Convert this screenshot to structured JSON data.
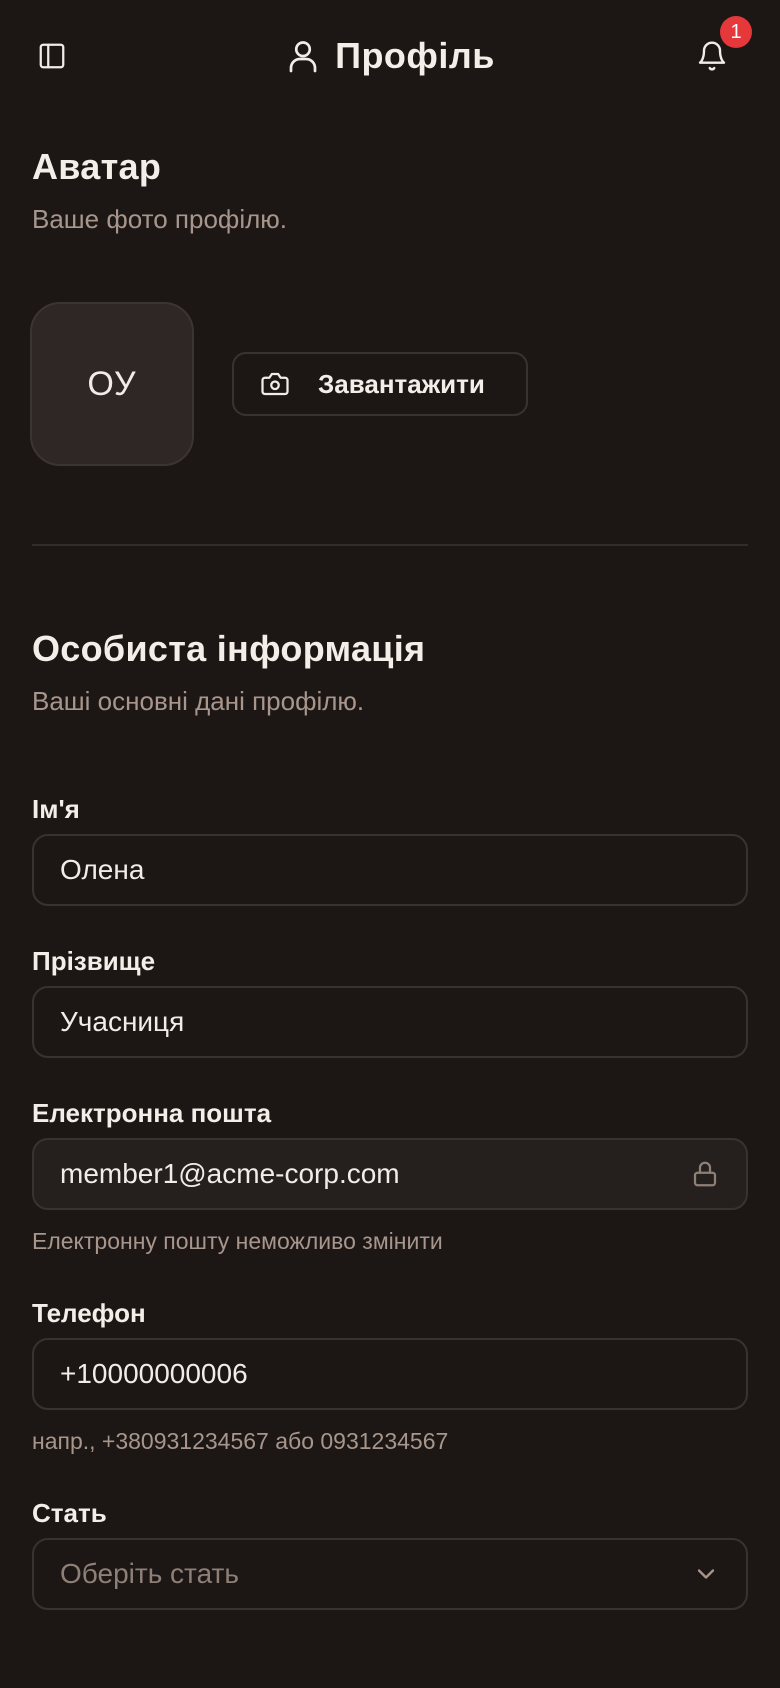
{
  "header": {
    "title": "Профіль",
    "notification_count": "1"
  },
  "avatar_section": {
    "title": "Аватар",
    "subtitle": "Ваше фото профілю.",
    "initials": "ОУ",
    "upload_label": "Завантажити"
  },
  "personal_section": {
    "title": "Особиста інформація",
    "subtitle": "Ваші основні дані профілю."
  },
  "fields": {
    "first_name": {
      "label": "Ім'я",
      "value": "Олена"
    },
    "last_name": {
      "label": "Прізвище",
      "value": "Учасниця"
    },
    "email": {
      "label": "Електронна пошта",
      "value": "member1@acme-corp.com",
      "hint": "Електронну пошту неможливо змінити"
    },
    "phone": {
      "label": "Телефон",
      "value": "+10000000006",
      "hint": "напр., +380931234567 або 0931234567"
    },
    "gender": {
      "label": "Стать",
      "placeholder": "Оберіть стать"
    }
  },
  "colors": {
    "background": "#1c1715",
    "badge": "#e5383b",
    "muted_text": "#a8968c"
  },
  "icons": [
    "sidebar-toggle-icon",
    "user-icon",
    "bell-icon",
    "camera-icon",
    "lock-icon",
    "chevron-down-icon"
  ]
}
